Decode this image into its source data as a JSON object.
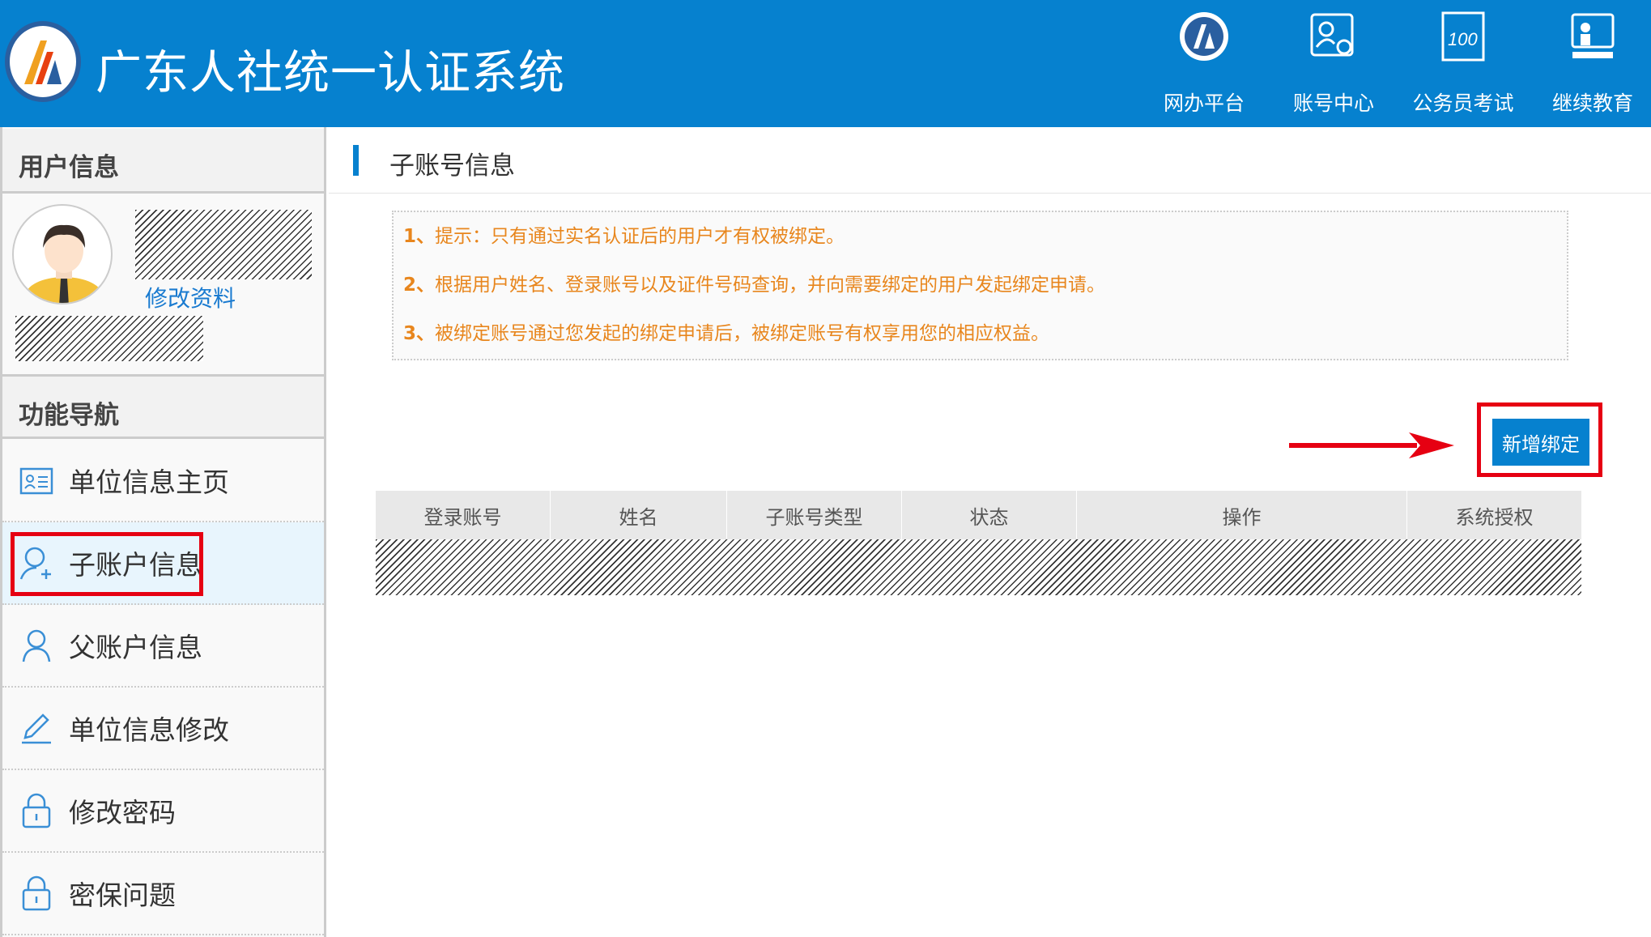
{
  "header": {
    "title": "广东人社统一认证系统",
    "nav": [
      {
        "label": "网办平台",
        "icon": "government-emblem-icon"
      },
      {
        "label": "账号中心",
        "icon": "account-settings-icon"
      },
      {
        "label": "公务员考试",
        "icon": "exam-score-icon"
      },
      {
        "label": "继续教育",
        "icon": "education-icon"
      }
    ]
  },
  "sidebar": {
    "user_section": "用户信息",
    "edit_profile": "修改资料",
    "nav_section": "功能导航",
    "items": [
      {
        "label": "单位信息主页",
        "icon": "id-card-icon"
      },
      {
        "label": "子账户信息",
        "icon": "user-add-icon",
        "active": true
      },
      {
        "label": "父账户信息",
        "icon": "user-icon"
      },
      {
        "label": "单位信息修改",
        "icon": "edit-icon"
      },
      {
        "label": "修改密码",
        "icon": "lock-icon"
      },
      {
        "label": "密保问题",
        "icon": "lock-icon"
      }
    ]
  },
  "main": {
    "title": "子账号信息",
    "notices": [
      {
        "num": "1、",
        "text": "提示：只有通过实名认证后的用户才有权被绑定。"
      },
      {
        "num": "2、",
        "text": "根据用户姓名、登录账号以及证件号码查询，并向需要绑定的用户发起绑定申请。"
      },
      {
        "num": "3、",
        "text": "被绑定账号通过您发起的绑定申请后，被绑定账号有权享用您的相应权益。"
      }
    ],
    "add_button": "新增绑定",
    "table": {
      "columns": [
        "登录账号",
        "姓名",
        "子账号类型",
        "状态",
        "操作",
        "系统授权"
      ]
    }
  },
  "colors": {
    "brand": "#0681cf",
    "notice": "#e8861d",
    "highlight": "#e60012"
  }
}
